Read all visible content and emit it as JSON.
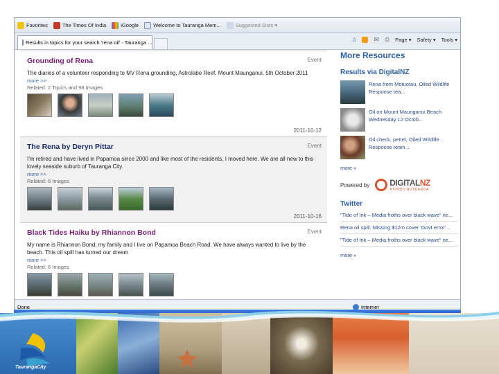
{
  "favorites_bar": {
    "favorites": "Favorites",
    "items": [
      "The Times Of India",
      "iGoogle",
      "Welcome to Tauranga Mem...",
      "Suggested Sites ▾"
    ]
  },
  "tab": {
    "label": "Results in topics for your search 'rena oil' - Tauranga ..."
  },
  "toolbar": {
    "page": "Page ▾",
    "safety": "Safety ▾",
    "tools": "Tools ▾"
  },
  "results": [
    {
      "title": "Grounding of Rena",
      "type": "Event",
      "description": "The diaries of a volunteer responding to MV Rena grounding, Astrolabe Reef, Mount Maunganui, 5th October 2011",
      "more": "more >>",
      "related": "Related: 2 Topics and 98 Images",
      "date": "2011-10-12"
    },
    {
      "title": "The Rena by Deryn Pittar",
      "type": "Event",
      "description": "I'm retired and have lived in Papamoa since 2000 and like most of the residents, I moved here. We are all new to this lovely seaside suburb of Tauranga City.",
      "more": "more >>",
      "related": "Related: 6 Images",
      "date": "2011-10-16"
    },
    {
      "title": "Black Tides Haiku by Rhiannon Bond",
      "type": "Event",
      "description": "My name is Rhiannon Bond, my family and I live on Papamoa Beach Road. We have always wanted to live by the beach. This oil spill has turned our dream",
      "more": "more >>",
      "related": "Related: 6 Images",
      "date": "2011-10-16"
    }
  ],
  "sidebar": {
    "heading": "More Resources",
    "digitalnz_heading": "Results via DigitalNZ",
    "digitalnz_items": [
      "Rena from Motuotau, Oiled Wildlife Response tea...",
      "Oil on Mount Maunganui Beach Wednesday 12 Octob...",
      "Oil check, petrel, Oiled Wildlife Response team..."
    ],
    "more": "more »",
    "powered_by": "Powered by",
    "digitalnz_logo_a": "DIGITAL",
    "digitalnz_logo_b": "NZ",
    "digitalnz_logo_sub": "ATIHIKO AOTEAROA",
    "twitter_heading": "Twitter",
    "tweets": [
      "\"Tide of Ink – Media froths over black wave\" ne...",
      "Rena oil spill: Missing $12m cover 'Govt error'...",
      "\"Tide of Ink – Media froths over black wave\" ne..."
    ],
    "twitter_more": "more »"
  },
  "status": {
    "done": "Done",
    "zone": "Internet"
  },
  "banner": {
    "logo_text": "TaurangaCity"
  }
}
